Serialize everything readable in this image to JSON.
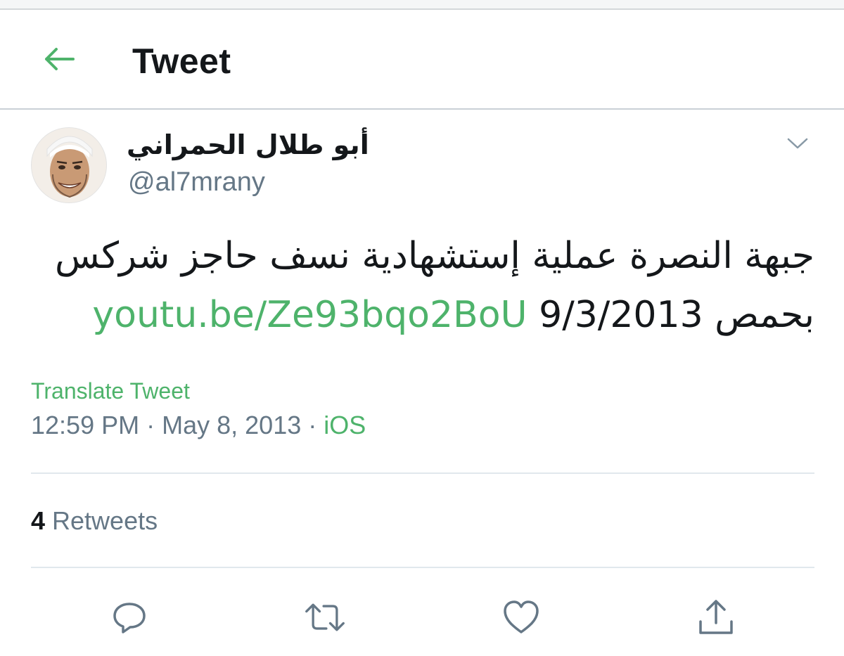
{
  "header": {
    "title": "Tweet",
    "back_icon": "arrow-left-icon",
    "accent_color": "#4eb36b"
  },
  "tweet": {
    "author": {
      "display_name": "أبو طلال الحمراني",
      "handle": "@al7mrany"
    },
    "text_main": "جبهة النصرة عملية إستشهادية نسف حاجز شركس بحمص 9/3/2013 ",
    "link": "youtu.be/Ze93bqo2BoU",
    "translate_label": "Translate Tweet",
    "time": "12:59 PM",
    "date": "May 8, 2013",
    "source": "iOS",
    "separator": "·"
  },
  "stats": {
    "retweet_count": "4",
    "retweet_label": "Retweets"
  },
  "actions": [
    {
      "name": "reply",
      "icon": "reply-icon"
    },
    {
      "name": "retweet",
      "icon": "retweet-icon"
    },
    {
      "name": "like",
      "icon": "heart-icon"
    },
    {
      "name": "share",
      "icon": "share-icon"
    }
  ],
  "colors": {
    "text": "#14171a",
    "secondary": "#657786",
    "link": "#4eb36b",
    "divider": "#e1e8ed"
  }
}
